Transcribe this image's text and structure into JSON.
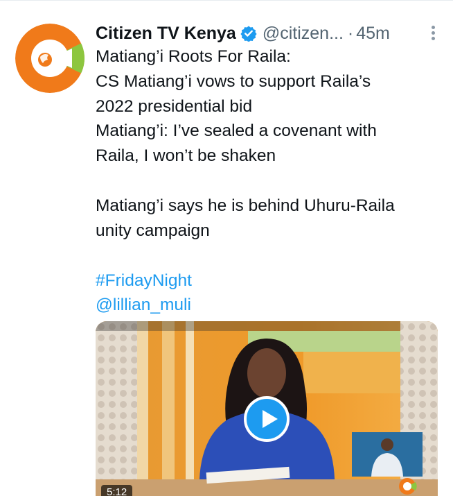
{
  "tweet": {
    "author_name": "Citizen TV Kenya",
    "handle": "@citizen...",
    "separator": "·",
    "time": "45m",
    "text_lines": [
      "Matiang’i Roots For Raila:",
      "CS Matiang’i vows to support Raila’s",
      "2022 presidential bid",
      "Matiang’i: I’ve sealed a covenant with",
      "Raila, I won’t be shaken"
    ],
    "text_para2": [
      "Matiang’i says he is behind Uhuru-Raila",
      "unity campaign"
    ],
    "hashtag": "#FridayNight",
    "mention": "@lillian_muli"
  },
  "media": {
    "duration": "5:12"
  },
  "colors": {
    "link": "#1d9bf0",
    "verified": "#1d9bf0",
    "brand_orange": "#f07a1a",
    "brand_green": "#8dc63f"
  },
  "icons": {
    "verified": "verified-badge-icon",
    "more": "more-vertical-icon",
    "play": "play-icon"
  }
}
